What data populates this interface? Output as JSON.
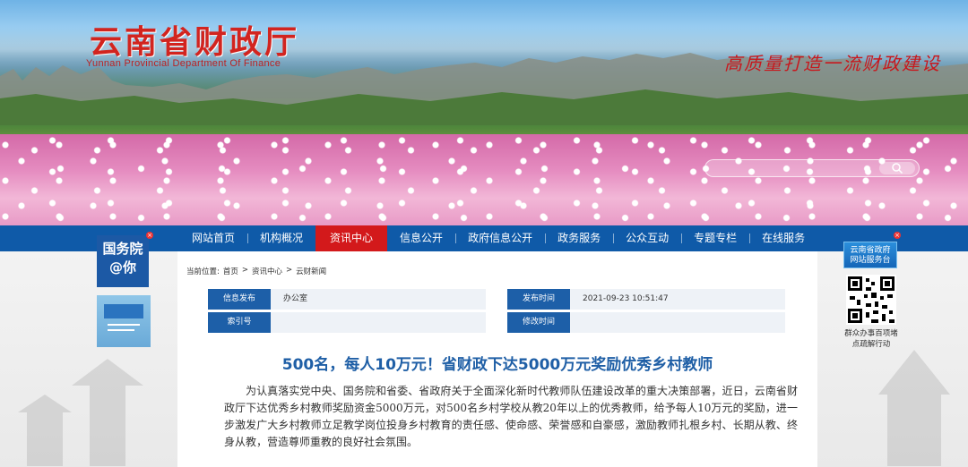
{
  "header": {
    "title_cn": "云南省财政厅",
    "title_en": "Yunnan Provincial Department Of Finance",
    "slogan": "高质量打造一流财政建设"
  },
  "nav": {
    "items": [
      "网站首页",
      "机构概况",
      "资讯中心",
      "信息公开",
      "政府信息公开",
      "政务服务",
      "公众互动",
      "专题专栏",
      "在线服务"
    ],
    "active_index": 2
  },
  "breadcrumb": {
    "prefix": "当前位置:",
    "items": [
      "首页",
      "资讯中心",
      "云财新闻"
    ],
    "separator": ">"
  },
  "meta": {
    "rows": [
      {
        "label1": "信息发布",
        "value1": "办公室",
        "label2": "发布时间",
        "value2": "2021-09-23 10:51:47"
      },
      {
        "label1": "索引号",
        "value1": "",
        "label2": "修改时间",
        "value2": ""
      }
    ]
  },
  "article": {
    "title": "500名，每人10万元！省财政下达5000万元奖励优秀乡村教师",
    "body": "为认真落实党中央、国务院和省委、省政府关于全面深化新时代教师队伍建设改革的重大决策部署，近日，云南省财政厅下达优秀乡村教师奖励资金5000万元，对500名乡村学校从教20年以上的优秀教师，给予每人10万元的奖励，进一步激发广大乡村教师立足教学岗位投身乡村教育的责任感、使命感、荣誉感和自豪感，激励教师扎根乡村、长期从教、终身从教，营造尊师重教的良好社会氛围。"
  },
  "ads": {
    "left1": {
      "line1": "国务院",
      "line2": "@你"
    },
    "right1": {
      "line1": "云南省政府",
      "line2": "网站服务台"
    },
    "qr_caption": {
      "line1": "群众办事百项堵",
      "line2": "点疏解行动"
    }
  },
  "colors": {
    "nav_bg": "#0f5aa8",
    "nav_active": "#d3191b",
    "title_red": "#d2241f",
    "label_blue": "#1d5fa8",
    "article_title": "#1f5fa6"
  }
}
